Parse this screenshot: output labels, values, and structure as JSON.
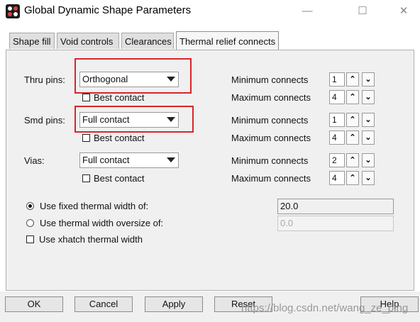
{
  "window": {
    "title": "Global Dynamic Shape Parameters",
    "minimize": "—",
    "maximize": "☐",
    "close": "✕"
  },
  "tabs": [
    "Shape fill",
    "Void controls",
    "Clearances",
    "Thermal relief connects"
  ],
  "active_tab": "Thermal relief connects",
  "rows": [
    {
      "label": "Thru pins:",
      "select": "Orthogonal",
      "checkbox": "Best contact",
      "min_label": "Minimum connects",
      "min_value": "1",
      "max_label": "Maximum connects",
      "max_value": "4"
    },
    {
      "label": "Smd pins:",
      "select": "Full contact",
      "checkbox": "Best contact",
      "min_label": "Minimum connects",
      "min_value": "1",
      "max_label": "Maximum connects",
      "max_value": "4"
    },
    {
      "label": "Vias:",
      "select": "Full contact",
      "checkbox": "Best contact",
      "min_label": "Minimum connects",
      "min_value": "2",
      "max_label": "Maximum connects",
      "max_value": "4"
    }
  ],
  "thermal": {
    "fixed_label": "Use fixed thermal width of:",
    "fixed_value": "20.0",
    "oversize_label": "Use thermal width oversize of:",
    "oversize_value": "0.0",
    "xhatch_label": "Use xhatch thermal width"
  },
  "buttons": {
    "ok": "OK",
    "cancel": "Cancel",
    "apply": "Apply",
    "reset": "Reset",
    "help": "Help"
  },
  "watermark": "https://blog.csdn.net/wang_ze_ping",
  "colors": {
    "highlight": "#d9252a"
  }
}
